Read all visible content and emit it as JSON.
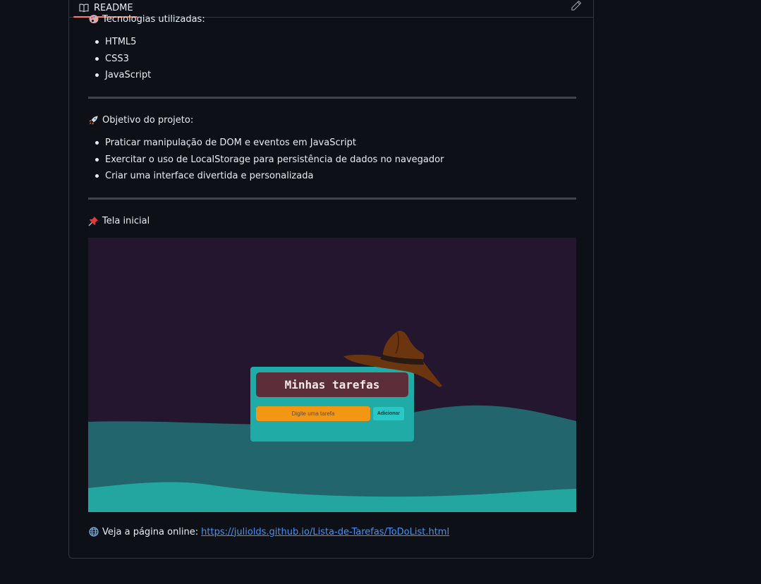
{
  "readme": {
    "tab_label": "README",
    "edit_tooltip": "Edit file"
  },
  "sections": {
    "tech_heading": "Tecnologias utilizadas:",
    "tech_items": [
      "HTML5",
      "CSS3",
      "JavaScript"
    ],
    "goal_heading": "Objetivo do projeto:",
    "goal_items": [
      "Praticar manipulação de DOM e eventos em JavaScript",
      "Exercitar o uso de LocalStorage para persistência de dados no navegador",
      "Criar uma interface divertida e personalizada"
    ],
    "screen_heading": "Tela inicial",
    "online_label": "Veja a página online:",
    "online_url": "https://juliolds.github.io/Lista-de-Tarefas/ToDoList.html"
  },
  "preview": {
    "app_title": "Minhas tarefas",
    "input_placeholder": "Digite uma tarefa",
    "add_button": "Adicionar"
  },
  "colors": {
    "background": "#0d1117",
    "text": "#e6edf3",
    "link": "#4493f8",
    "tab_underline": "#f78166",
    "preview_bg": "#23162e",
    "card": "#21aba6",
    "title_box": "#5b2e3a",
    "input": "#f29613",
    "button": "#28c8c6"
  }
}
